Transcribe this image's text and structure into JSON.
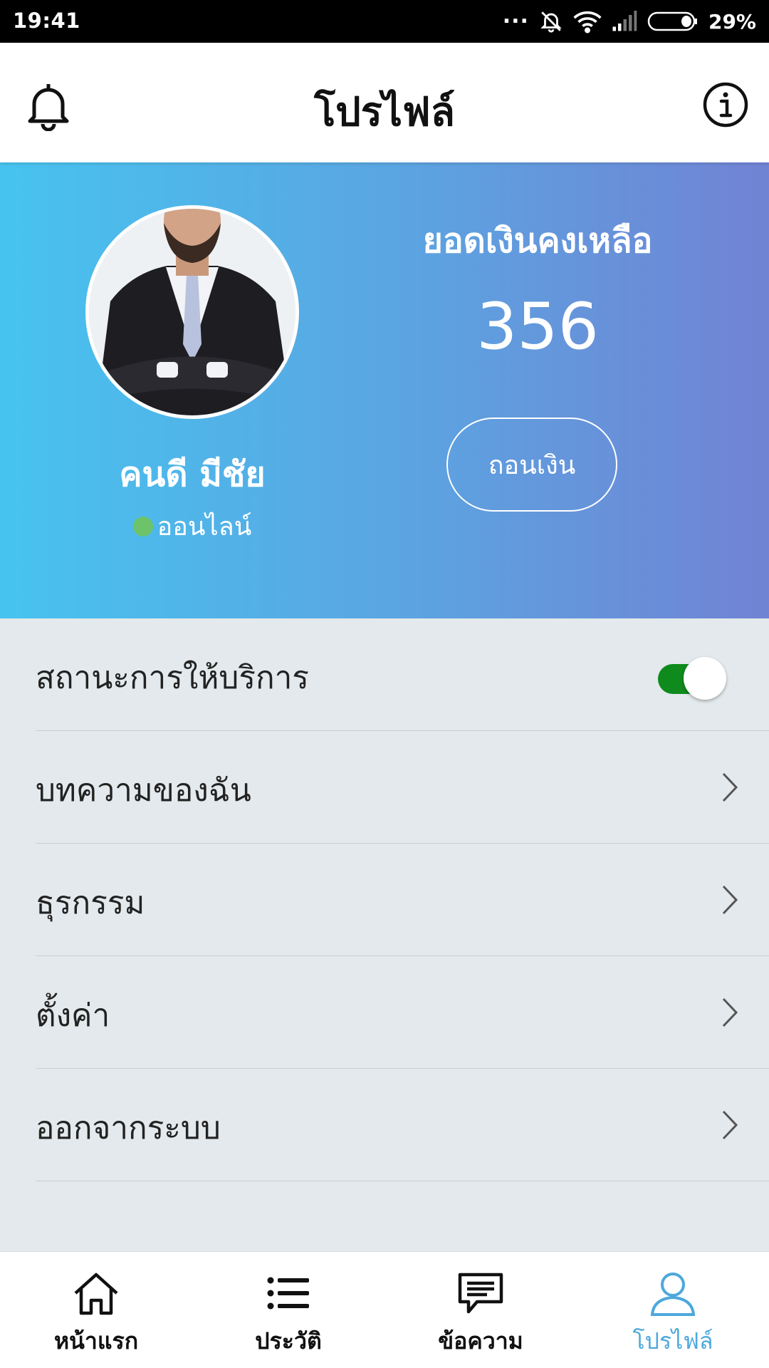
{
  "status_bar": {
    "time": "19:41",
    "dots": "...",
    "battery": "29%",
    "icons": [
      "notifications-off-icon",
      "wifi-icon",
      "signal-icon",
      "battery-icon"
    ]
  },
  "header": {
    "title": "โปรไฟล์",
    "left_icon": "bell-icon",
    "right_icon": "info-icon"
  },
  "profile": {
    "name": "คนดี มีชัย",
    "status": "ออนไลน์",
    "status_color": "#6cc36a",
    "balance_label": "ยอดเงินคงเหลือ",
    "balance_value": "356",
    "withdraw_label": "ถอนเงิน"
  },
  "menu": [
    {
      "label": "สถานะการให้บริการ",
      "type": "toggle",
      "on": true
    },
    {
      "label": "บทความของฉัน",
      "type": "link"
    },
    {
      "label": "ธุรกรรม",
      "type": "link"
    },
    {
      "label": "ตั้งค่า",
      "type": "link"
    },
    {
      "label": "ออกจากระบบ",
      "type": "link"
    }
  ],
  "bottom_nav": [
    {
      "label": "หน้าแรก",
      "icon": "home-icon",
      "active": false
    },
    {
      "label": "ประวัติ",
      "icon": "list-icon",
      "active": false
    },
    {
      "label": "ข้อความ",
      "icon": "message-icon",
      "active": false
    },
    {
      "label": "โปรไฟล์",
      "icon": "user-icon",
      "active": true
    }
  ],
  "colors": {
    "gradient_start": "#47c3ef",
    "gradient_end": "#7183d4",
    "toggle_on": "#0f8a1c",
    "nav_active": "#4da8dc"
  }
}
